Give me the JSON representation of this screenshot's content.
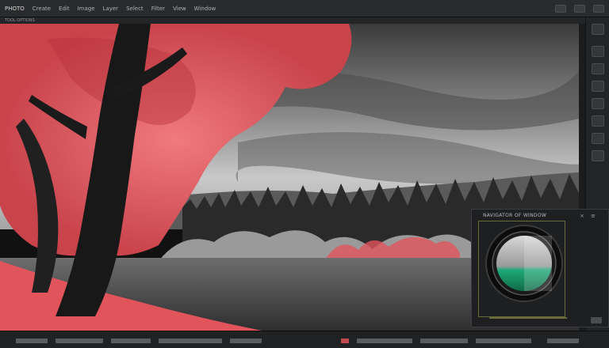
{
  "menu": {
    "app_name": "PHOTO",
    "items": [
      "Create",
      "Edit",
      "Image",
      "Layer",
      "Select",
      "Filter",
      "View",
      "Window"
    ]
  },
  "options_bar": {
    "label": "TOOL OPTIONS"
  },
  "navigator_panel": {
    "title": "NAVIGATOR OF WINDOW",
    "close_icon": "×",
    "menu_icon": "≡"
  },
  "colors": {
    "foliage_red": "#e2545c",
    "lens_green": "#1fa978"
  }
}
